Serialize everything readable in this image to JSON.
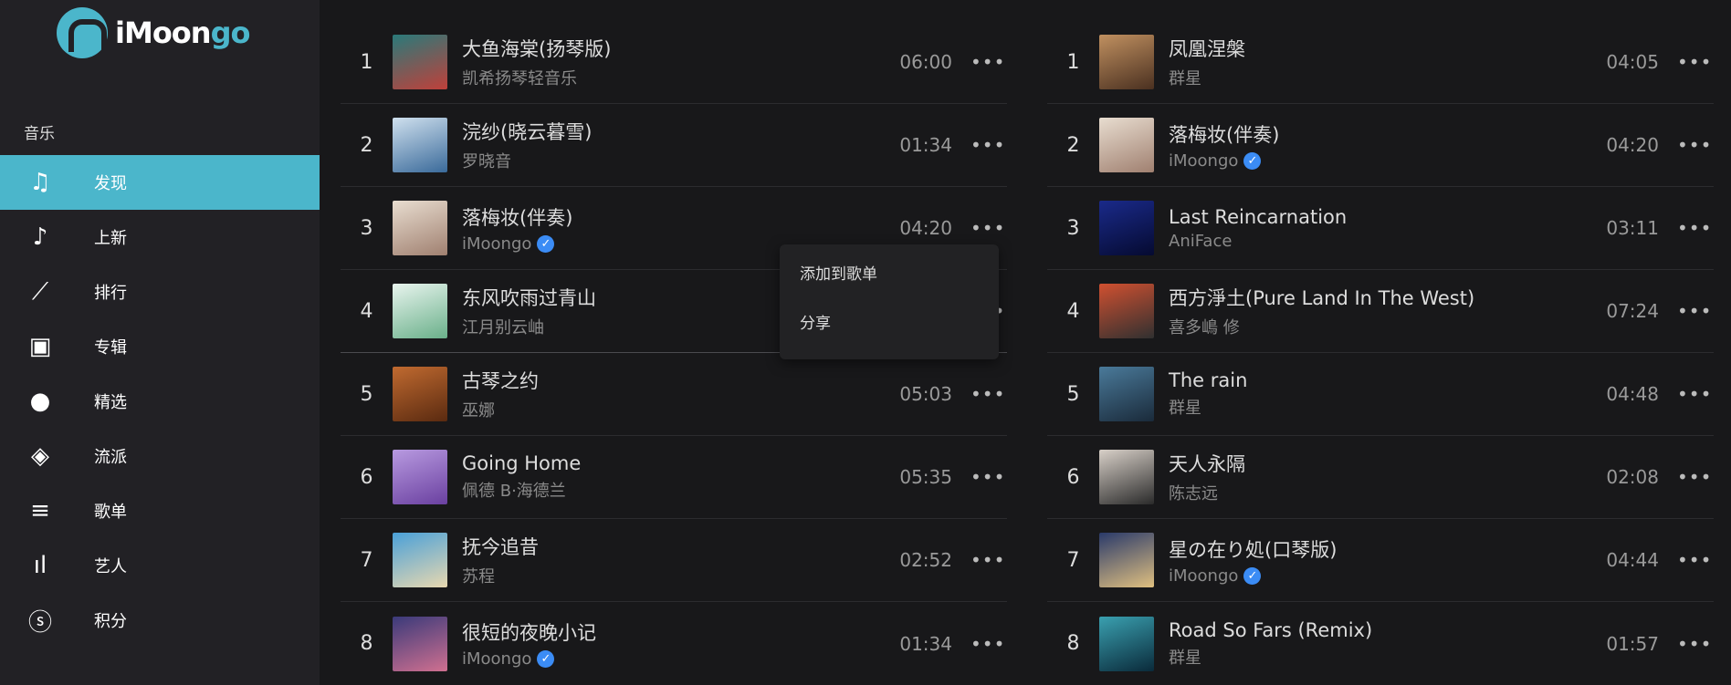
{
  "app": {
    "logo_main": "iMoon",
    "logo_accent": "go"
  },
  "sidebar": {
    "section": "音乐",
    "items": [
      {
        "label": "发现",
        "icon": "music-notes-icon",
        "active": true
      },
      {
        "label": "上新",
        "icon": "music-note-icon"
      },
      {
        "label": "排行",
        "icon": "line-chart-icon"
      },
      {
        "label": "专辑",
        "icon": "album-icon"
      },
      {
        "label": "精选",
        "icon": "drop-icon"
      },
      {
        "label": "流派",
        "icon": "layers-icon"
      },
      {
        "label": "歌单",
        "icon": "playlist-icon"
      },
      {
        "label": "艺人",
        "icon": "bar-chart-icon"
      },
      {
        "label": "积分",
        "icon": "coin-icon"
      }
    ]
  },
  "left_list": [
    {
      "n": "1",
      "title": "大鱼海棠(扬琴版)",
      "artist": "凯希扬琴轻音乐",
      "dur": "06:00",
      "colors": [
        "#2a7a7a",
        "#c0403a"
      ]
    },
    {
      "n": "2",
      "title": "浣纱(晓云暮雪)",
      "artist": "罗晓音",
      "dur": "01:34",
      "colors": [
        "#cfe0ee",
        "#3a6a9a"
      ]
    },
    {
      "n": "3",
      "title": "落梅妆(伴奏)",
      "artist": "iMoongo",
      "verified": true,
      "dur": "04:20",
      "colors": [
        "#e8ddd0",
        "#a08070"
      ]
    },
    {
      "n": "4",
      "title": "东风吹雨过青山",
      "artist": "江月别云岫",
      "dur": "",
      "colors": [
        "#e8f4ee",
        "#6ab08a"
      ]
    },
    {
      "n": "5",
      "title": "古琴之约",
      "artist": "巫娜",
      "dur": "05:03",
      "colors": [
        "#c06a30",
        "#5a2a10"
      ]
    },
    {
      "n": "6",
      "title": "Going Home",
      "artist": "佩德 B·海德兰",
      "dur": "05:35",
      "colors": [
        "#b89ae0",
        "#6a40a0"
      ]
    },
    {
      "n": "7",
      "title": "抚今追昔",
      "artist": "苏程",
      "dur": "02:52",
      "colors": [
        "#4aa0d8",
        "#e8d8b0"
      ]
    },
    {
      "n": "8",
      "title": "很短的夜晚小记",
      "artist": "iMoongo",
      "verified": true,
      "dur": "01:34",
      "colors": [
        "#3a3a7a",
        "#d07090"
      ]
    }
  ],
  "right_list": [
    {
      "n": "1",
      "title": "凤凰涅槃",
      "artist": "群星",
      "dur": "04:05",
      "colors": [
        "#c09060",
        "#4a3020"
      ]
    },
    {
      "n": "2",
      "title": "落梅妆(伴奏)",
      "artist": "iMoongo",
      "verified": true,
      "dur": "04:20",
      "colors": [
        "#e8ddd0",
        "#a08070"
      ]
    },
    {
      "n": "3",
      "title": "Last Reincarnation",
      "artist": "AniFace",
      "dur": "03:11",
      "colors": [
        "#1a2a8a",
        "#050a30"
      ]
    },
    {
      "n": "4",
      "title": "西方淨土(Pure Land In The West)",
      "artist": "喜多嶋 修",
      "dur": "07:24",
      "colors": [
        "#d05030",
        "#303030"
      ]
    },
    {
      "n": "5",
      "title": "The rain",
      "artist": "群星",
      "dur": "04:48",
      "colors": [
        "#4a7a9a",
        "#1a2a3a"
      ]
    },
    {
      "n": "6",
      "title": "天人永隔",
      "artist": "陈志远",
      "dur": "02:08",
      "colors": [
        "#d8d0c8",
        "#2a2a2a"
      ]
    },
    {
      "n": "7",
      "title": "星の在り処(口琴版)",
      "artist": "iMoongo",
      "verified": true,
      "dur": "04:44",
      "colors": [
        "#2a3a6a",
        "#e0c080"
      ]
    },
    {
      "n": "8",
      "title": "Road So Fars (Remix)",
      "artist": "群星",
      "dur": "01:57",
      "colors": [
        "#3aa0b0",
        "#0a2a3a"
      ]
    }
  ],
  "more_label": "•••",
  "verified_mark": "✓",
  "context_menu": {
    "items": [
      "添加到歌单",
      "分享"
    ]
  },
  "colors": {
    "accent": "#4bb6cb",
    "verified": "#3b8cf5"
  }
}
